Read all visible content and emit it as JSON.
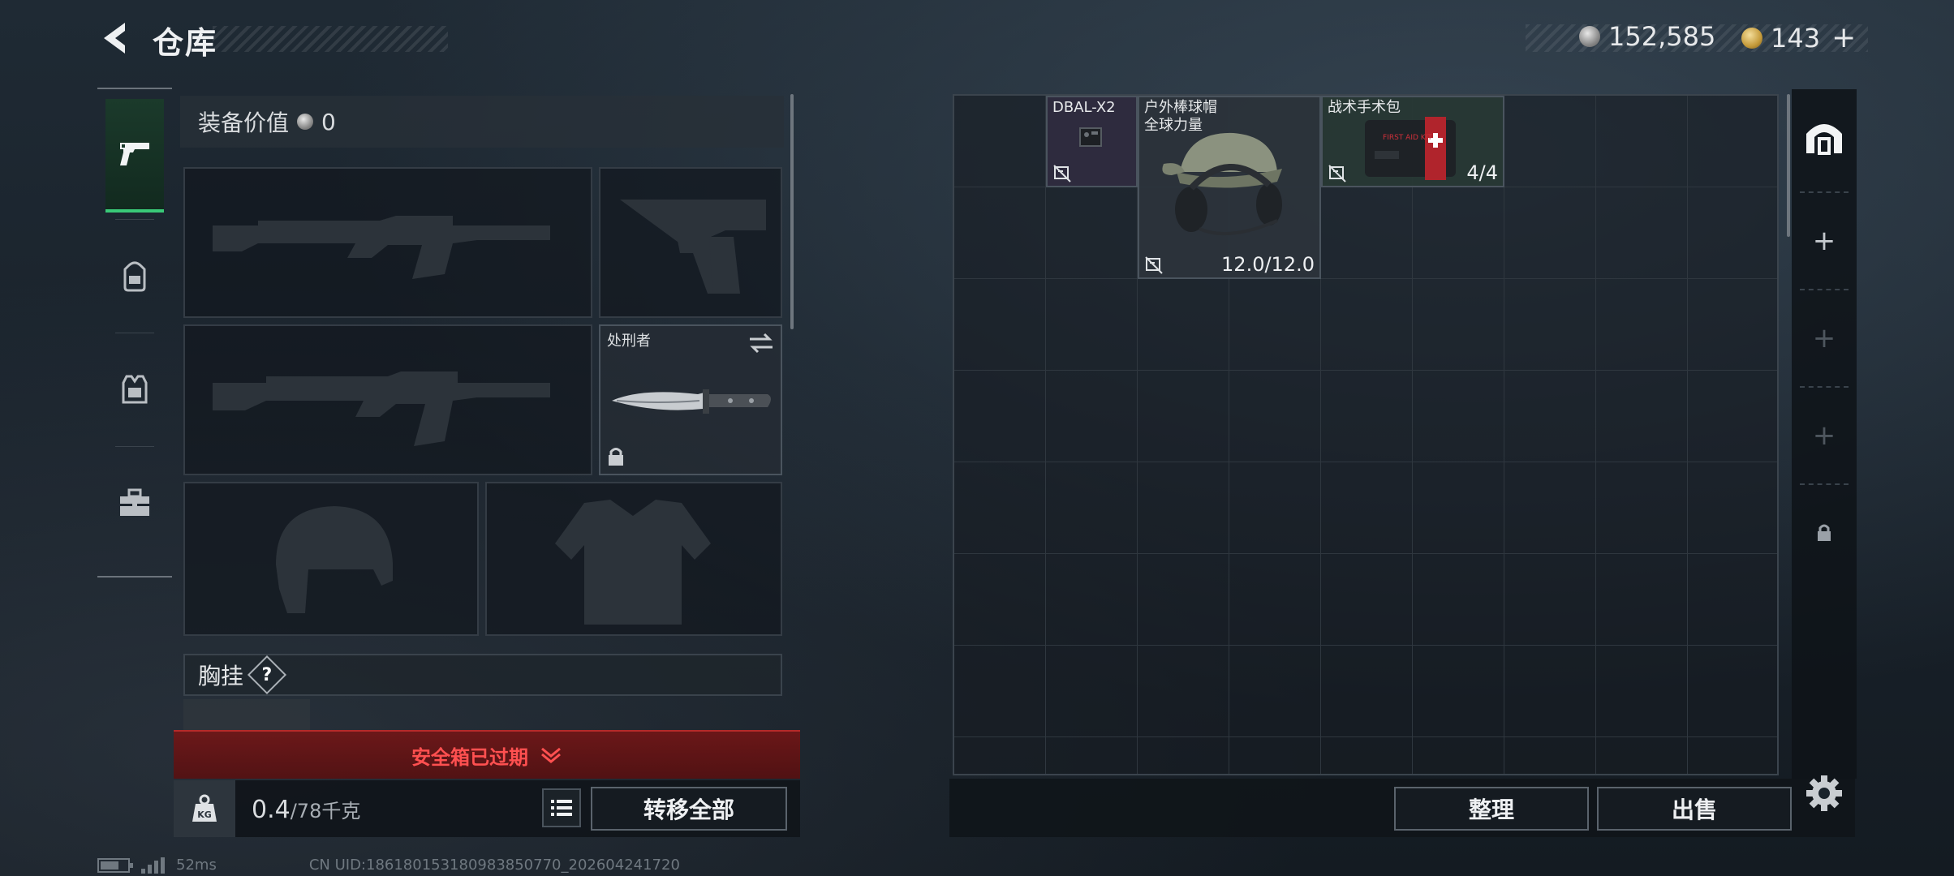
{
  "header": {
    "title": "仓库",
    "currency_silver": "152,585",
    "currency_gold": "143",
    "plus": "+"
  },
  "nav": {
    "items": [
      {
        "name": "weapons",
        "icon": "pistol-icon",
        "active": true
      },
      {
        "name": "backpack",
        "icon": "backpack-icon",
        "active": false
      },
      {
        "name": "vest",
        "icon": "vest-icon",
        "active": false
      },
      {
        "name": "toolbox",
        "icon": "toolbox-icon",
        "active": false
      }
    ]
  },
  "equipment": {
    "value_label": "装备价值",
    "value": "0",
    "melee_label": "处刑者",
    "chest_label": "胸挂",
    "help": "?"
  },
  "safebox": {
    "warning": "安全箱已过期"
  },
  "weight": {
    "kg_label": "KG",
    "current": "0.4",
    "max": "/78千克",
    "fill": 0.005
  },
  "buttons": {
    "transfer_all": "转移全部",
    "organize": "整理",
    "sell": "出售"
  },
  "stash": {
    "items": [
      {
        "name": "DBAL-X2",
        "count": ""
      },
      {
        "name": "户外棒球帽\n全球力量",
        "count": "12.0/12.0"
      },
      {
        "name": "战术手术包",
        "count": "4/4"
      }
    ]
  },
  "status": {
    "ping": "52ms",
    "uid": "CN UID:1861801531809838507​70_202604241720"
  },
  "colors": {
    "accent_green": "#39c978",
    "warning_red": "#ff5050",
    "panel_bg": "#151b21"
  }
}
